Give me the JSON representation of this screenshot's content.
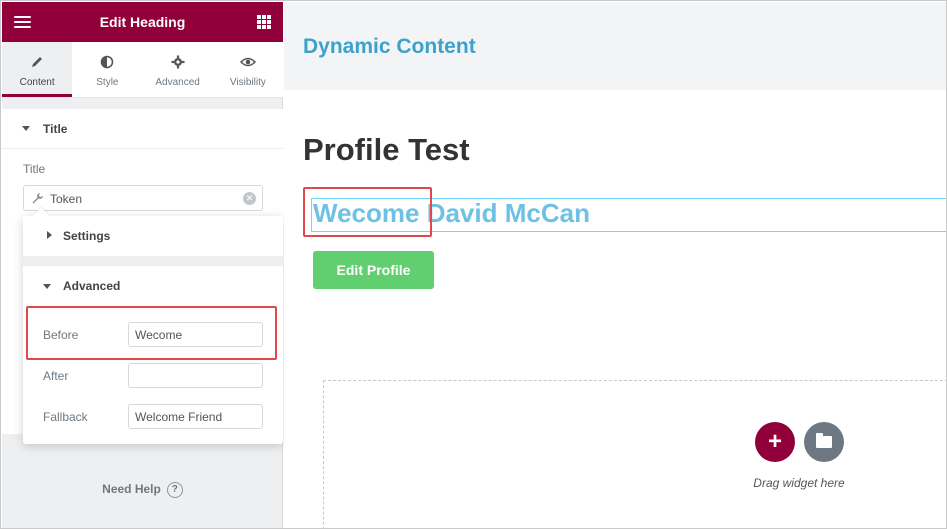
{
  "sidebar": {
    "header_title": "Edit Heading",
    "tabs": [
      {
        "label": "Content",
        "icon": "pencil-icon"
      },
      {
        "label": "Style",
        "icon": "half-circle-icon"
      },
      {
        "label": "Advanced",
        "icon": "gear-icon"
      },
      {
        "label": "Visibility",
        "icon": "eye-icon"
      }
    ],
    "active_tab": "Content",
    "section_title": "Title",
    "title_field_label": "Title",
    "title_field_value": "Token",
    "help_label": "Need Help"
  },
  "popover": {
    "settings_label": "Settings",
    "advanced_label": "Advanced",
    "before_label": "Before",
    "before_value": "Wecome",
    "after_label": "After",
    "after_value": "",
    "fallback_label": "Fallback",
    "fallback_value": "Welcome Friend"
  },
  "preview": {
    "site_title": "Dynamic Content",
    "page_title": "Profile Test",
    "heading_before": "Wecome",
    "heading_name": "David McCan",
    "edit_button_label": "Edit Profile",
    "add_button_label": "+",
    "drag_label": "Drag widget here"
  },
  "colors": {
    "brand": "#92003b",
    "site_title": "#3ca1cd",
    "heading": "#6ec1e4",
    "button": "#61ce70",
    "highlight": "#e2474a"
  }
}
